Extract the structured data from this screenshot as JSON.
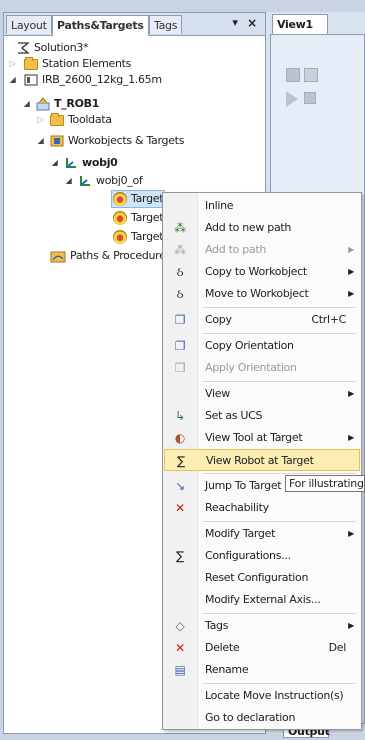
{
  "left_panel": {
    "tabs": [
      {
        "label": "Layout",
        "active": false
      },
      {
        "label": "Paths&Targets",
        "active": true
      },
      {
        "label": "Tags",
        "active": false
      }
    ],
    "pin_icon": "▾",
    "close_icon": "×",
    "tree": [
      {
        "label": "Solution3*",
        "icon": "solution-icon"
      },
      {
        "label": "Station Elements",
        "icon": "folder-icon"
      },
      {
        "label": "IRB_2600_12kg_1.65m",
        "icon": "robot-controller-icon"
      },
      {
        "label": "T_ROB1",
        "icon": "task-icon"
      },
      {
        "label": "Tooldata",
        "icon": "tooldata-folder-icon"
      },
      {
        "label": "Workobjects & Targets",
        "icon": "workobjects-folder-icon"
      },
      {
        "label": "wobj0",
        "icon": "workobject-icon"
      },
      {
        "label": "wobj0_of",
        "icon": "workobject-frame-icon"
      },
      {
        "label": "Target_",
        "icon": "target-icon"
      },
      {
        "label": "Target_",
        "icon": "target-icon"
      },
      {
        "label": "Target_",
        "icon": "target-icon"
      },
      {
        "label": "Paths & Procedures",
        "icon": "paths-folder-icon"
      }
    ]
  },
  "right_panel": {
    "view_tab_label": "View1",
    "view_tab_close": "×",
    "output_tab_label": "Output"
  },
  "context_menu": {
    "items": [
      {
        "label": "Inline",
        "icon": null,
        "enabled": true
      },
      {
        "label": "Add to new path",
        "icon": "add-path-icon",
        "enabled": true
      },
      {
        "label": "Add to path",
        "icon": "add-to-path-icon",
        "enabled": false,
        "submenu": true
      },
      {
        "label": "Copy to Workobject",
        "icon": "copy-workobject-icon",
        "enabled": true,
        "submenu": true
      },
      {
        "label": "Move to Workobject",
        "icon": "move-workobject-icon",
        "enabled": true,
        "submenu": true
      },
      {
        "label": "Copy",
        "shortcut": "Ctrl+C",
        "icon": "copy-icon",
        "enabled": true
      },
      {
        "label": "Copy Orientation",
        "icon": "copy-orientation-icon",
        "enabled": true
      },
      {
        "label": "Apply Orientation",
        "icon": "apply-orientation-icon",
        "enabled": false
      },
      {
        "label": "View",
        "icon": null,
        "enabled": true,
        "submenu": true
      },
      {
        "label": "Set as UCS",
        "icon": "ucs-icon",
        "enabled": true
      },
      {
        "label": "View Tool at Target",
        "icon": "view-tool-icon",
        "enabled": true,
        "submenu": true
      },
      {
        "label": "View Robot at Target",
        "icon": "view-robot-icon",
        "enabled": true,
        "highlighted": true
      },
      {
        "label": "Jump To Target",
        "icon": "jump-target-icon",
        "enabled": true
      },
      {
        "label": "Reachability",
        "icon": "reachability-icon",
        "enabled": true
      },
      {
        "label": "Modify Target",
        "icon": null,
        "enabled": true,
        "submenu": true
      },
      {
        "label": "Configurations...",
        "icon": "configurations-icon",
        "enabled": true
      },
      {
        "label": "Reset Configuration",
        "icon": null,
        "enabled": true
      },
      {
        "label": "Modify External Axis...",
        "icon": null,
        "enabled": true
      },
      {
        "label": "Tags",
        "icon": "tag-icon",
        "enabled": true,
        "submenu": true
      },
      {
        "label": "Delete",
        "shortcut": "Del",
        "icon": "delete-icon",
        "enabled": true
      },
      {
        "label": "Rename",
        "icon": "rename-icon",
        "enabled": true
      },
      {
        "label": "Locate Move Instruction(s)",
        "icon": null,
        "enabled": true
      },
      {
        "label": "Go to declaration",
        "icon": null,
        "enabled": true
      }
    ]
  },
  "tooltip": {
    "text": "For illustrating"
  }
}
